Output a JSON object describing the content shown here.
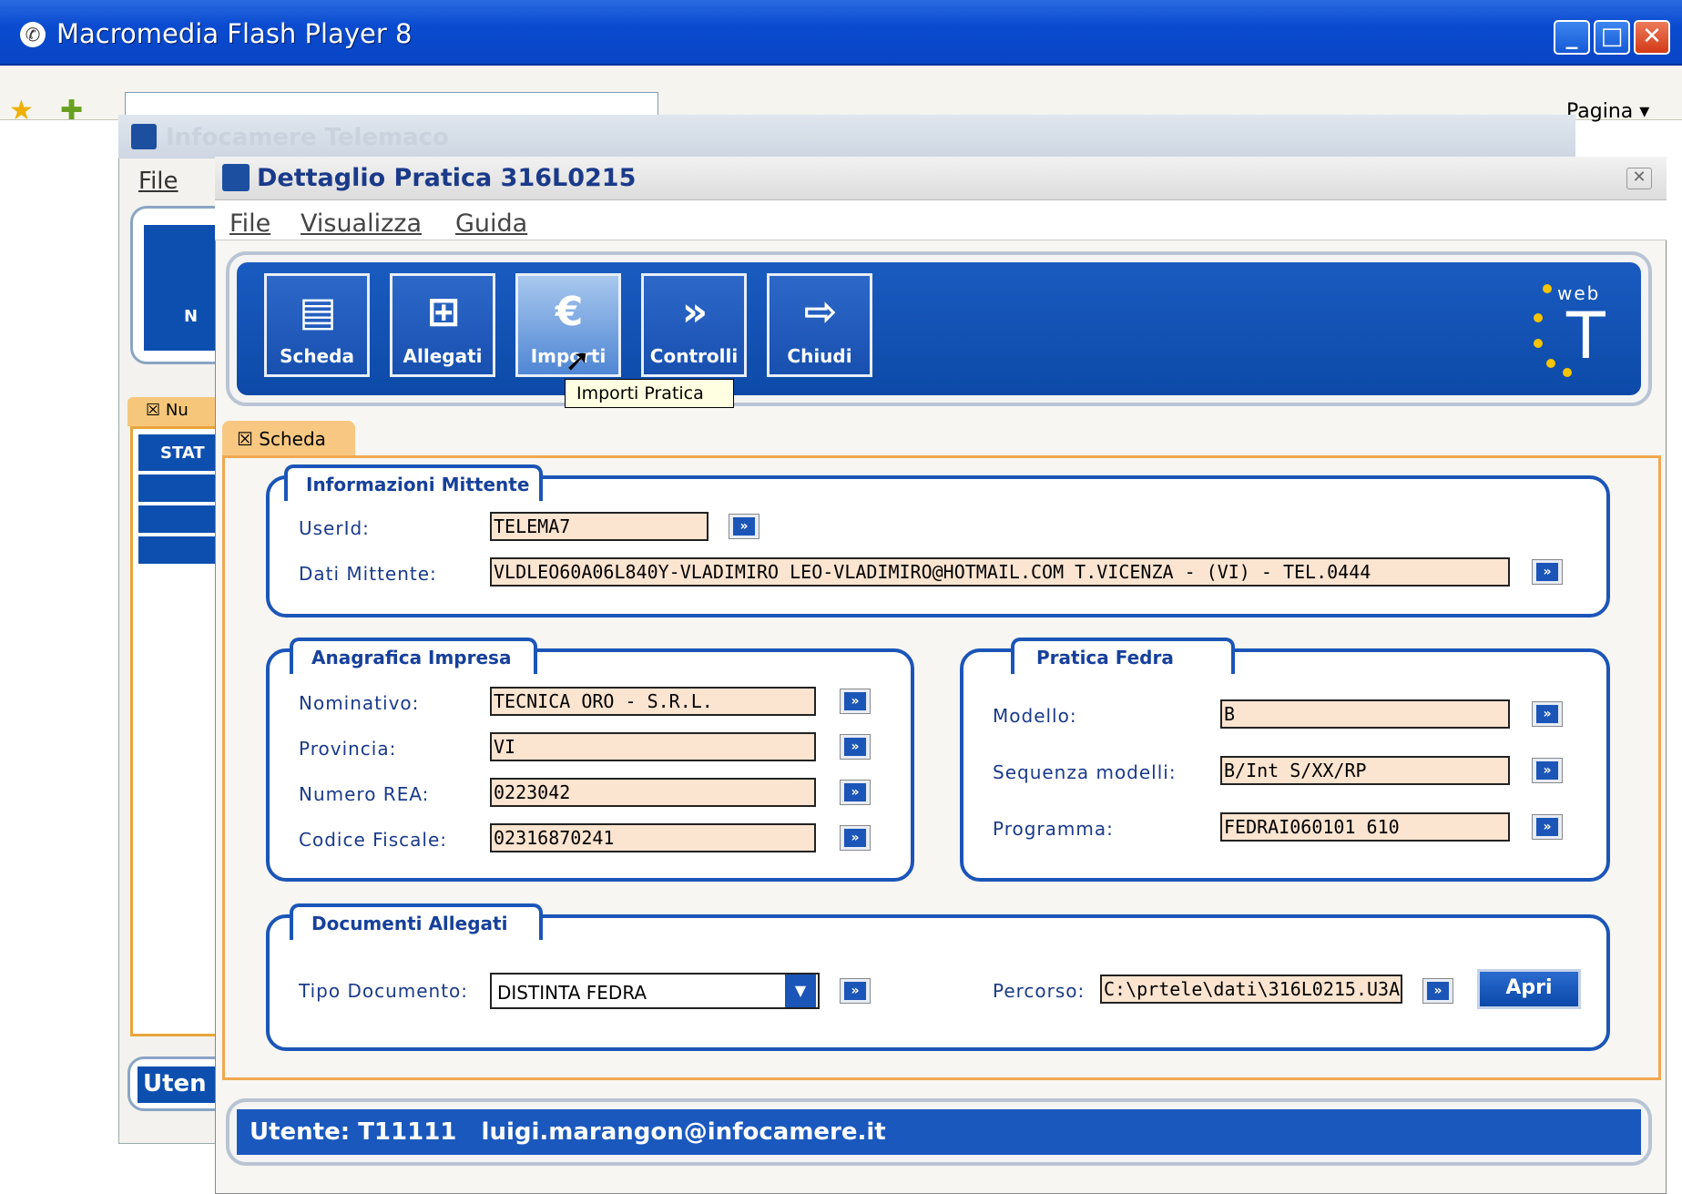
{
  "outer_window": {
    "title": "Macromedia Flash Player 8"
  },
  "browser": {
    "pagina_label": "Pagina"
  },
  "bg_window": {
    "title": "Infocamere Telemaco",
    "file_menu": "File",
    "panel_label": "N",
    "tab_label": "Nu",
    "list_header": "STAT",
    "bottom_label": "Uten"
  },
  "dialog": {
    "title": "Dettaglio Pratica 316L0215",
    "menu": [
      "File",
      "Visualizza",
      "Guida"
    ],
    "toolbar": [
      {
        "label": "Scheda",
        "icon": "document-icon"
      },
      {
        "label": "Allegati",
        "icon": "attachments-icon"
      },
      {
        "label": "Importi",
        "icon": "euro-icon"
      },
      {
        "label": "Controlli",
        "icon": "forward-icon"
      },
      {
        "label": "Chiudi",
        "icon": "exit-icon"
      }
    ],
    "logo_text": "web",
    "logo_letter": "T",
    "tooltip": "Importi Pratica",
    "tab": "Scheda",
    "informazioni": {
      "title": "Informazioni Mittente",
      "userid_label": "UserId:",
      "userid": "TELEMA7",
      "dati_label": "Dati Mittente:",
      "dati": "VLDLEO60A06L840Y-VLADIMIRO LEO-VLADIMIRO@HOTMAIL.COM T.VICENZA - (VI) - TEL.0444"
    },
    "anagrafica": {
      "title": "Anagrafica Impresa",
      "fields": [
        {
          "label": "Nominativo:",
          "value": "TECNICA ORO - S.R.L."
        },
        {
          "label": "Provincia:",
          "value": "VI"
        },
        {
          "label": "Numero REA:",
          "value": "0223042"
        },
        {
          "label": "Codice Fiscale:",
          "value": "02316870241"
        }
      ]
    },
    "fedra": {
      "title": "Pratica Fedra",
      "fields": [
        {
          "label": "Modello:",
          "value": "B"
        },
        {
          "label": "Sequenza modelli:",
          "value": "B/Int S/XX/RP"
        },
        {
          "label": "Programma:",
          "value": "FEDRAI060101 610"
        }
      ]
    },
    "documenti": {
      "title": "Documenti Allegati",
      "tipo_label": "Tipo Documento:",
      "tipo_value": "DISTINTA FEDRA",
      "percorso_label": "Percorso:",
      "percorso_value": "C:\\prtele\\dati\\316L0215.U3A",
      "apri": "Apri"
    },
    "status": "Utente: T11111   luigi.marangon@infocamere.it"
  }
}
